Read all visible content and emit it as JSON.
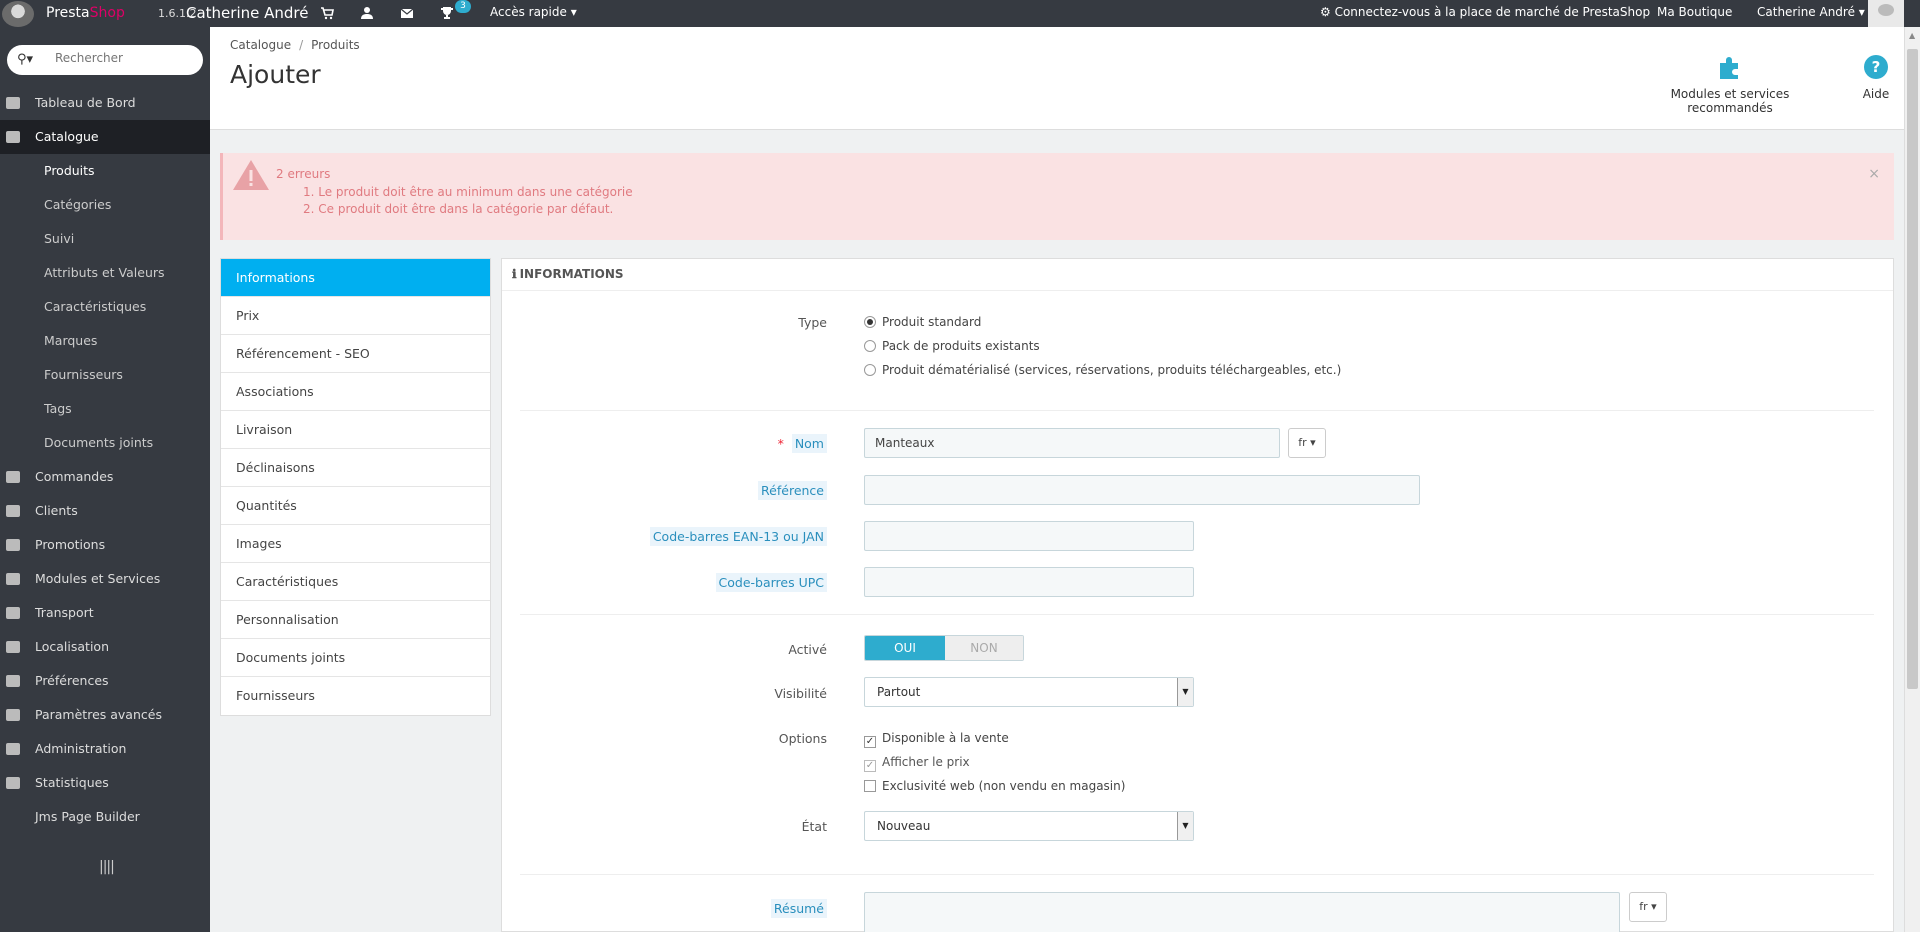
{
  "topbar": {
    "brand_presta": "Presta",
    "brand_shop": "Shop",
    "version": "1.6.1.2",
    "shop_name": "Catherine André",
    "icons": [
      "cart-icon",
      "user-icon",
      "envelope-icon",
      "trophy-icon"
    ],
    "trophy_badge": "3",
    "quick_access": "Accès rapide",
    "marketplace": "Connectez-vous à la place de marché de PrestaShop",
    "my_shop": "Ma Boutique",
    "employee": "Catherine André"
  },
  "sidebar": {
    "search_placeholder": "Rechercher",
    "items": [
      {
        "label": "Tableau de Bord",
        "icon": "dashboard-icon"
      },
      {
        "label": "Catalogue",
        "icon": "book-icon"
      },
      {
        "label": "Commandes",
        "icon": "credit-card-icon"
      },
      {
        "label": "Clients",
        "icon": "users-icon"
      },
      {
        "label": "Promotions",
        "icon": "tag-icon"
      },
      {
        "label": "Modules et Services",
        "icon": "puzzle-icon"
      },
      {
        "label": "Transport",
        "icon": "truck-icon"
      },
      {
        "label": "Localisation",
        "icon": "globe-icon"
      },
      {
        "label": "Préférences",
        "icon": "wrench-icon"
      },
      {
        "label": "Paramètres avancés",
        "icon": "cogs-icon"
      },
      {
        "label": "Administration",
        "icon": "gear-icon"
      },
      {
        "label": "Statistiques",
        "icon": "bar-chart-icon"
      },
      {
        "label": "Jms Page Builder",
        "icon": ""
      }
    ],
    "catalogue_sub": [
      "Produits",
      "Catégories",
      "Suivi",
      "Attributs et Valeurs",
      "Caractéristiques",
      "Marques",
      "Fournisseurs",
      "Tags",
      "Documents joints"
    ],
    "collapse_glyph": "||||"
  },
  "header": {
    "breadcrumb": [
      "Catalogue",
      "Produits"
    ],
    "title": "Ajouter",
    "modules_label": "Modules et services recommandés",
    "help_label": "Aide"
  },
  "alert": {
    "count": "2 erreurs",
    "errors": [
      "1. Le produit doit être au minimum dans une catégorie",
      "2. Ce produit doit être dans la catégorie par défaut."
    ],
    "close": "×"
  },
  "tabs": [
    "Informations",
    "Prix",
    "Référencement - SEO",
    "Associations",
    "Livraison",
    "Déclinaisons",
    "Quantités",
    "Images",
    "Caractéristiques",
    "Personnalisation",
    "Documents joints",
    "Fournisseurs"
  ],
  "form": {
    "panel_title": "Informations",
    "type_label": "Type",
    "type_options": [
      "Produit standard",
      "Pack de produits existants",
      "Produit dématérialisé (services, réservations, produits téléchargeables, etc.)"
    ],
    "name_label": "Nom",
    "name_value": "Manteaux",
    "lang": "fr",
    "reference_label": "Référence",
    "reference_value": "",
    "ean_label": "Code-barres EAN-13 ou JAN",
    "ean_value": "",
    "upc_label": "Code-barres UPC",
    "upc_value": "",
    "active_label": "Activé",
    "active_yes": "OUI",
    "active_no": "NON",
    "visibility_label": "Visibilité",
    "visibility_value": "Partout",
    "options_label": "Options",
    "options": [
      {
        "label": "Disponible à la vente",
        "checked": true
      },
      {
        "label": "Afficher le prix",
        "checked": true
      },
      {
        "label": "Exclusivité web (non vendu en magasin)",
        "checked": false
      }
    ],
    "condition_label": "État",
    "condition_value": "Nouveau",
    "summary_label": "Résumé"
  },
  "colors": {
    "topbar": "#363a41",
    "accent": "#00aff0",
    "toggle_on": "#2eacce",
    "alert_bg": "#fae2e3",
    "brand_pink": "#df0067"
  }
}
